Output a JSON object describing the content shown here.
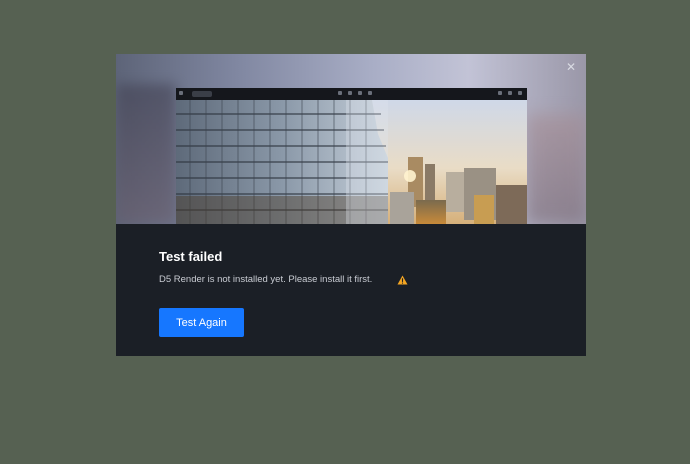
{
  "dialog": {
    "close_icon": "close-icon",
    "title": "Test failed",
    "message": "D5 Render is not installed yet. Please install it first.",
    "warning_icon": "warning-triangle-icon",
    "primary_button": "Test Again"
  },
  "colors": {
    "page_bg": "#566152",
    "dialog_bg": "#1b1f26",
    "accent": "#1677ff",
    "warning": "#f5a623"
  }
}
